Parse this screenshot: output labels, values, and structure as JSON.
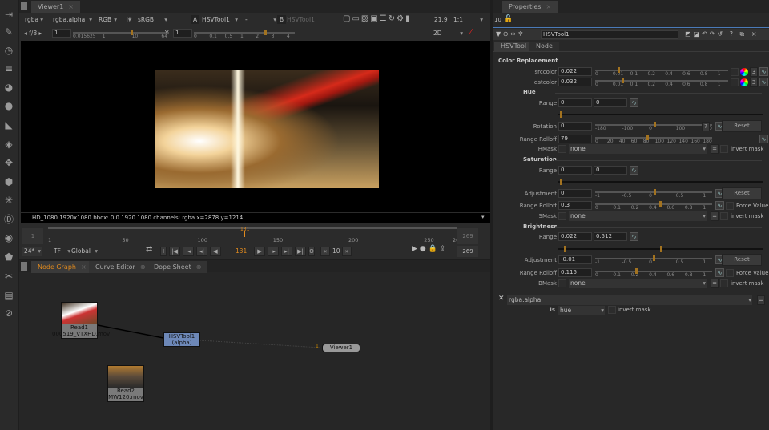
{
  "viewer": {
    "tab": "Viewer1",
    "channels": "rgba",
    "alpha_channel": "rgba.alpha",
    "display": "RGB",
    "ip": "IP",
    "lut": "sRGB",
    "input_a_label": "A",
    "input_a": "HSVTool1",
    "wipe": "-",
    "input_b_label": "B",
    "input_b": "HSVTool1",
    "zoom_text": "21.9",
    "zoom_ratio": "1:1",
    "fstop": "f/8",
    "gain": "1",
    "gain_ticks": [
      "0.015625",
      "1",
      "10",
      "64"
    ],
    "gamma_label": "Y",
    "gamma": "1",
    "gamma_ticks": [
      "0",
      "0.1",
      "0.5",
      "1",
      "2",
      "3",
      "4"
    ],
    "view_mode": "2D",
    "info": "HD_1080 1920x1080  bbox: 0 0 1920 1080 channels: rgba    x=2878 y=1214"
  },
  "timeline": {
    "start": "1",
    "end": "269",
    "current": "131",
    "ticks": [
      "1",
      "50",
      "100",
      "150",
      "200",
      "250",
      "269"
    ],
    "fps": "24*",
    "tf": "TF",
    "global": "Global",
    "step": "10",
    "end_frame": "269",
    "in_btn": "I",
    "out_btn": "O"
  },
  "node_tabs": [
    {
      "label": "Node Graph",
      "active": true
    },
    {
      "label": "Curve Editor"
    },
    {
      "label": "Dope Sheet"
    }
  ],
  "nodes": {
    "read1": {
      "name": "Read1",
      "file": "000519_VTXHD.mov"
    },
    "hsv": {
      "name": "HSVTool1",
      "sub": "(alpha)"
    },
    "viewer": {
      "name": "Viewer1",
      "input": "1"
    },
    "read2": {
      "name": "Read2",
      "file": "MW120.mov"
    }
  },
  "properties": {
    "tab": "Properties",
    "max_panels": "10",
    "node_name": "HSVTool1",
    "tabs": [
      "HSVTool",
      "Node"
    ],
    "rows": [
      {
        "type": "section",
        "label": "Color Replacement"
      },
      {
        "type": "color",
        "label": "srccolor",
        "value": "0.022",
        "ticks": [
          "0",
          "0.01",
          "0.1",
          "0.2",
          "0.4",
          "0.6",
          "0.8",
          "1"
        ],
        "handle": 0.17,
        "count": "3"
      },
      {
        "type": "color",
        "label": "dstcolor",
        "value": "0.032",
        "ticks": [
          "0",
          "0.01",
          "0.1",
          "0.2",
          "0.4",
          "0.6",
          "0.8",
          "1"
        ],
        "handle": 0.2,
        "count": "3"
      },
      {
        "type": "section",
        "label": "Hue"
      },
      {
        "type": "range2",
        "label": "Range",
        "v1": "0",
        "v2": "0"
      },
      {
        "type": "rangebar",
        "handles": [
          0
        ]
      },
      {
        "type": "reset",
        "label": "Rotation",
        "value": "0",
        "ticks": [
          "-180",
          "-100",
          "0",
          "100",
          "180"
        ],
        "handle": 0.5,
        "help": "?",
        "reset": "Reset"
      },
      {
        "type": "curve",
        "label": "Range Rolloff",
        "value": "79",
        "ticks": [
          "0",
          "20",
          "40",
          "60",
          "80",
          "100",
          "120",
          "140",
          "160",
          "180"
        ],
        "handle": 0.44
      },
      {
        "type": "mask",
        "label": "HMask",
        "value": "none",
        "invert": "invert mask"
      },
      {
        "type": "section",
        "label": "Saturation"
      },
      {
        "type": "range2",
        "label": "Range",
        "v1": "0",
        "v2": "0"
      },
      {
        "type": "rangebar",
        "handles": [
          0
        ]
      },
      {
        "type": "reset",
        "label": "Adjustment",
        "value": "0",
        "ticks": [
          "-1",
          "-0.5",
          "0",
          "0.5",
          "1"
        ],
        "handle": 0.5,
        "reset": "Reset"
      },
      {
        "type": "force",
        "label": "Range Rolloff",
        "value": "0.3",
        "ticks": [
          "0",
          "0.1",
          "0.2",
          "0.4",
          "0.6",
          "0.8",
          "1"
        ],
        "handle": 0.55,
        "force": "Force Value"
      },
      {
        "type": "mask",
        "label": "SMask",
        "value": "none",
        "invert": "invert mask"
      },
      {
        "type": "section",
        "label": "Brightness"
      },
      {
        "type": "range2",
        "label": "Range",
        "v1": "0.022",
        "v2": "0.512"
      },
      {
        "type": "rangebar",
        "handles": [
          0.02,
          0.5
        ]
      },
      {
        "type": "reset",
        "label": "Adjustment",
        "value": "-0.01",
        "ticks": [
          "-1",
          "-0.5",
          "0",
          "0.5",
          "1"
        ],
        "handle": 0.49,
        "reset": "Reset"
      },
      {
        "type": "force",
        "label": "Range Rolloff",
        "value": "0.115",
        "ticks": [
          "0",
          "0.1",
          "0.2",
          "0.4",
          "0.6",
          "0.8",
          "1"
        ],
        "handle": 0.34,
        "force": "Force Value"
      },
      {
        "type": "mask",
        "label": "BMask",
        "value": "none",
        "invert": "invert mask"
      }
    ],
    "mask_channel": "rgba.alpha",
    "is_label": "is",
    "is_value": "hue",
    "invert": "invert mask"
  },
  "colors": {
    "accent": "#e08a1e",
    "node_hsv": "#6d88b8",
    "bg": "#2b2b2b"
  }
}
